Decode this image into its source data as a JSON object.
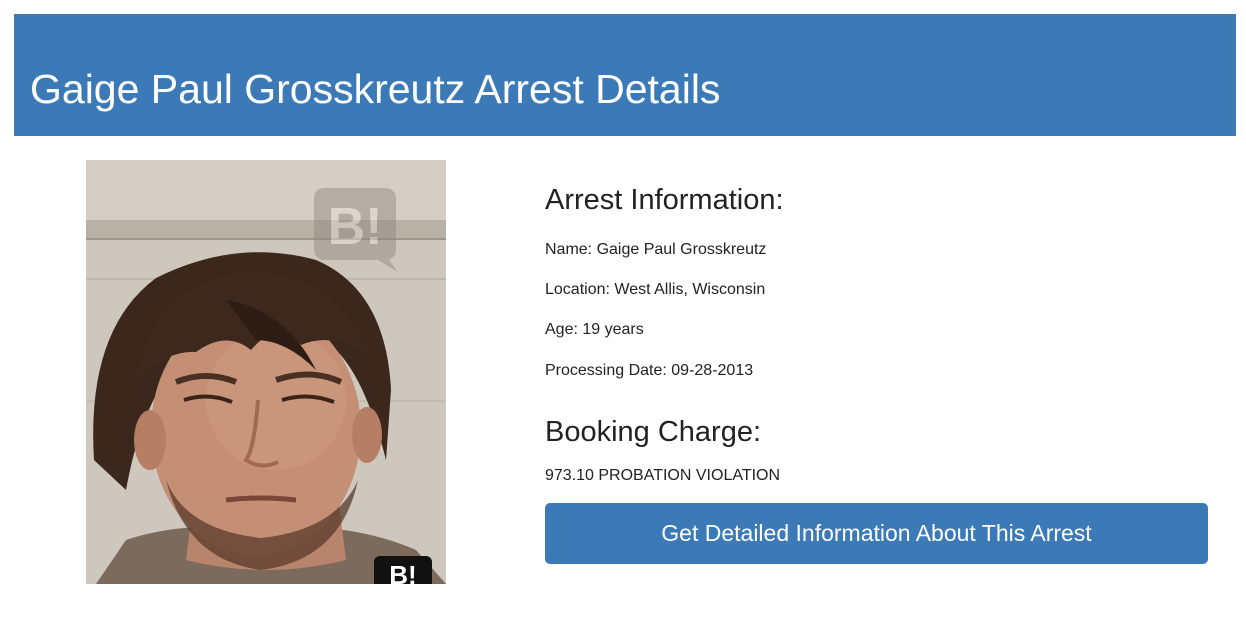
{
  "header": {
    "title": "Gaige Paul Grosskreutz Arrest Details"
  },
  "photo": {
    "watermark_top": "B!",
    "watermark_bottom": "B!"
  },
  "arrest_info": {
    "heading": "Arrest Information:",
    "name": "Name: Gaige Paul Grosskreutz",
    "location": "Location: West Allis, Wisconsin",
    "age": "Age: 19 years",
    "processing_date": "Processing Date: 09-28-2013"
  },
  "booking": {
    "heading": "Booking Charge:",
    "charge": "973.10 PROBATION VIOLATION"
  },
  "cta": {
    "label": "Get Detailed Information About This Arrest"
  },
  "colors": {
    "accent": "#3c7ab7",
    "text": "#222222"
  }
}
